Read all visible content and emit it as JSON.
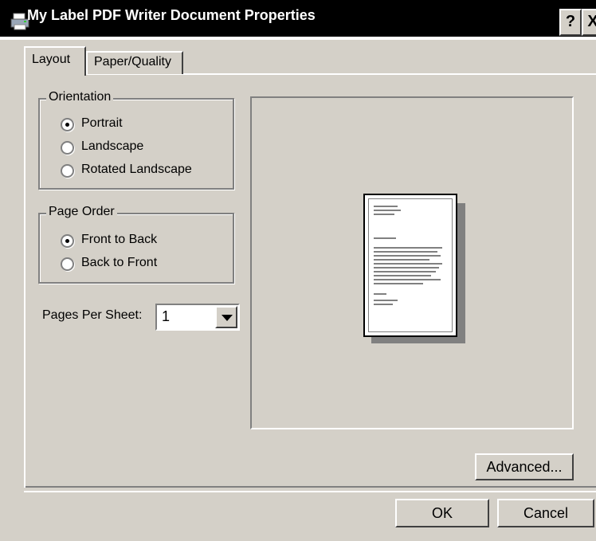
{
  "window": {
    "title": "My Label PDF Writer Document Properties",
    "icon": "printer-icon",
    "help_label": "?",
    "close_label": "X"
  },
  "tabs": [
    {
      "label": "Layout",
      "active": true
    },
    {
      "label": "Paper/Quality",
      "active": false
    }
  ],
  "orientation": {
    "label": "Orientation",
    "options": [
      "Portrait",
      "Landscape",
      "Rotated Landscape"
    ],
    "selected": "Portrait"
  },
  "page_order": {
    "label": "Page Order",
    "options": [
      "Front to Back",
      "Back to Front"
    ],
    "selected": "Front to Back"
  },
  "pages_per_sheet": {
    "label": "Pages Per Sheet:",
    "value": "1"
  },
  "preview": {
    "icon": "document-preview-icon"
  },
  "buttons": {
    "advanced": "Advanced...",
    "ok": "OK",
    "cancel": "Cancel"
  }
}
